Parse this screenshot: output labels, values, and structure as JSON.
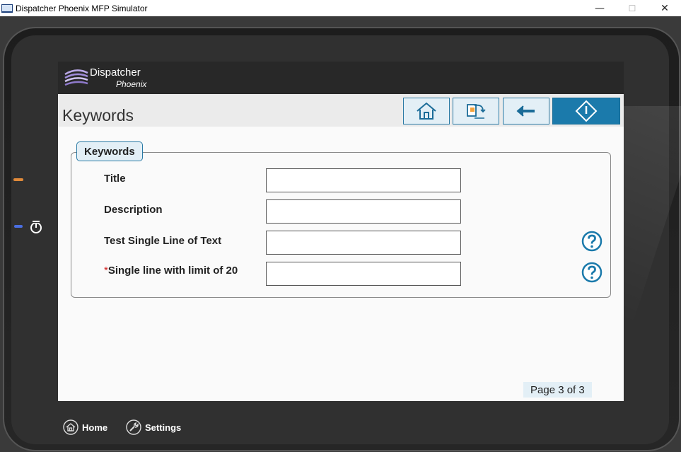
{
  "window": {
    "title": "Dispatcher Phoenix MFP Simulator",
    "minimize_glyph": "—",
    "maximize_glyph": "☐",
    "close_glyph": "✕"
  },
  "logo": {
    "line1": "Dispatcher",
    "line2": "Phoenix"
  },
  "header": {
    "title": "Keywords",
    "buttons": [
      "home-icon",
      "job-switch-icon",
      "back-arrow-icon",
      "start-diamond-icon"
    ]
  },
  "group": {
    "legend": "Keywords",
    "fields": [
      {
        "label": "Title",
        "value": "",
        "required": false,
        "help": false
      },
      {
        "label": "Description",
        "value": "",
        "required": false,
        "help": false
      },
      {
        "label": "Test Single Line of Text",
        "value": "",
        "required": false,
        "help": true
      },
      {
        "label": "Single line with limit of 20",
        "value": "",
        "required": true,
        "required_mark": "*",
        "help": true
      }
    ]
  },
  "pagination": {
    "label": "Page 3 of 3"
  },
  "bottom_bar": {
    "home_label": "Home",
    "settings_label": "Settings"
  },
  "colors": {
    "accent": "#1b7aab",
    "button_bg": "#e3eff6",
    "required": "#d02020"
  }
}
